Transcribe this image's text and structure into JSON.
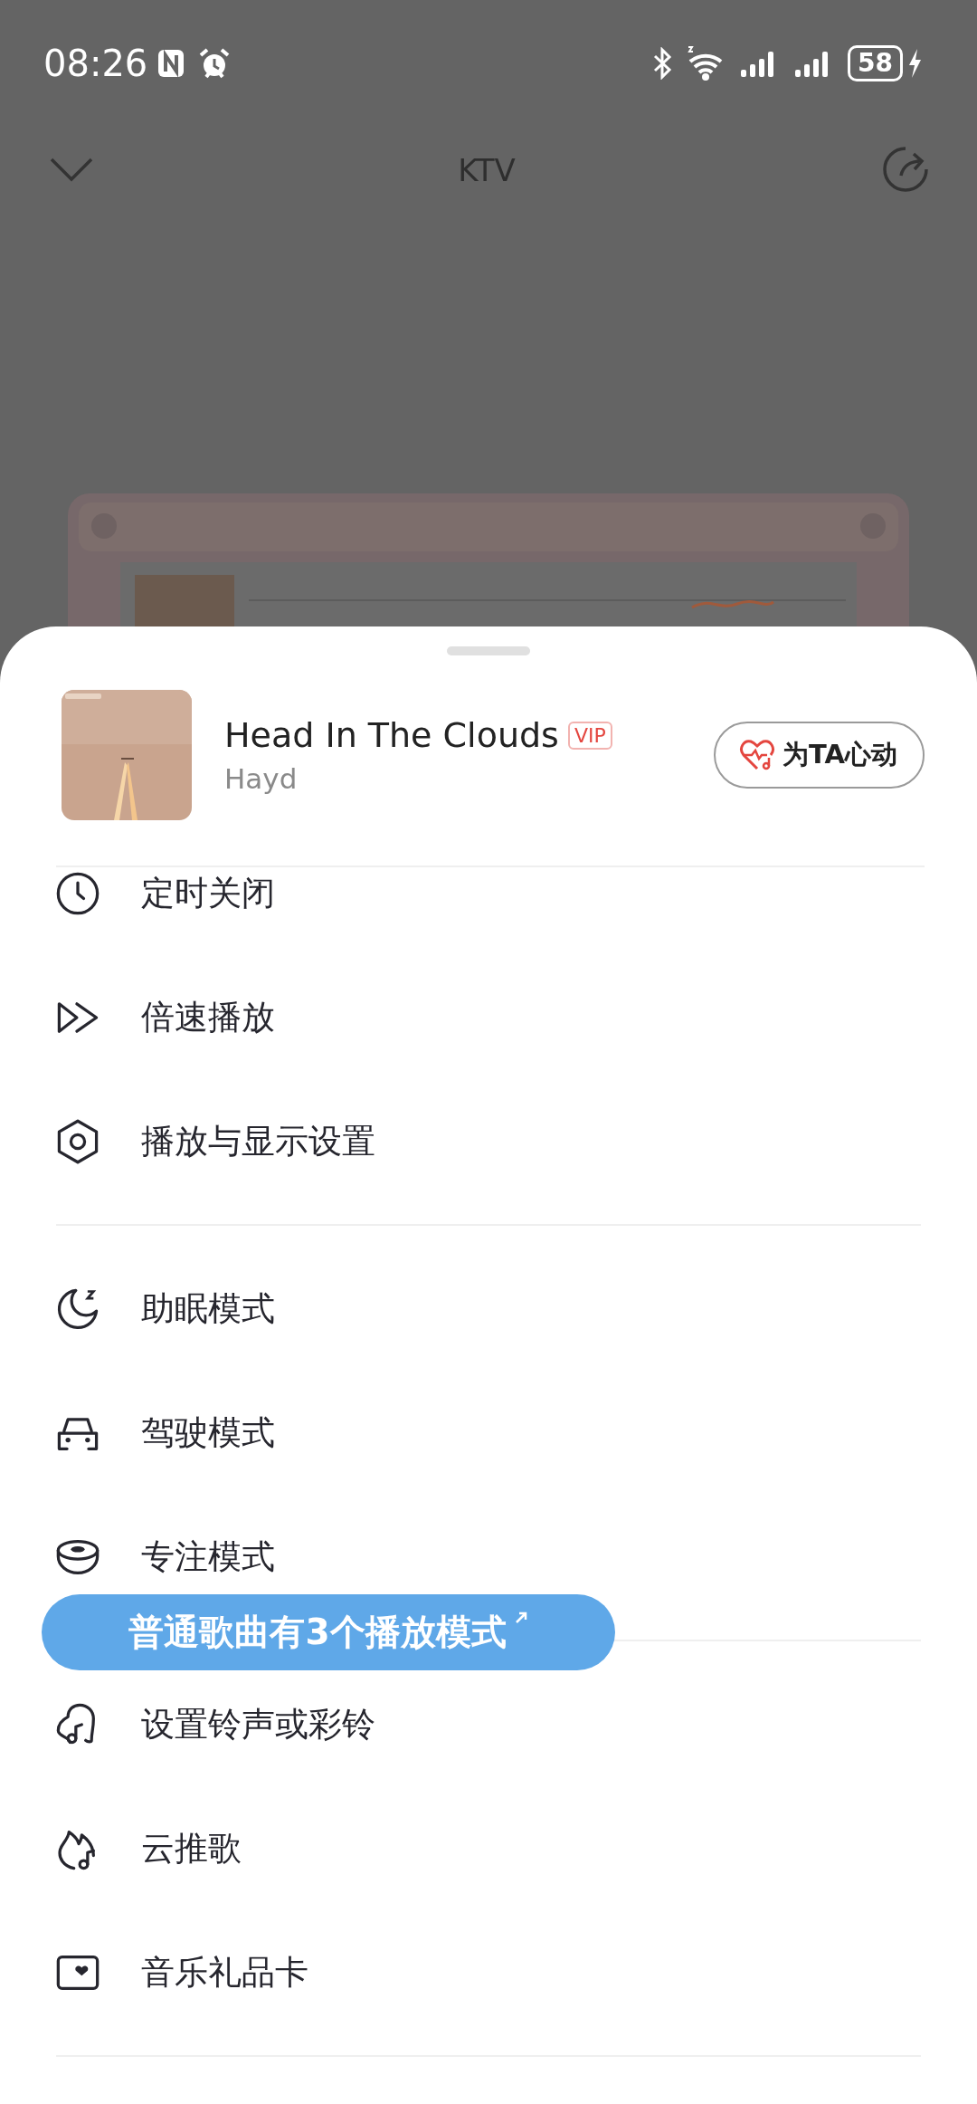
{
  "status_bar": {
    "time": "08:26",
    "battery": "58"
  },
  "header": {
    "title": "KTV"
  },
  "song": {
    "title": "Head In The Clouds",
    "badge": "VIP",
    "artist": "Hayd",
    "action": "为TA心动"
  },
  "menu_groups": [
    [
      {
        "kind": "clock",
        "label": "定时关闭"
      },
      {
        "kind": "speed",
        "label": "倍速播放"
      },
      {
        "kind": "settings",
        "label": "播放与显示设置"
      }
    ],
    [
      {
        "kind": "moon",
        "label": "助眠模式"
      },
      {
        "kind": "car",
        "label": "驾驶模式"
      },
      {
        "kind": "bowl",
        "label": "专注模式"
      }
    ],
    [
      {
        "kind": "bell",
        "label": "设置铃声或彩铃"
      },
      {
        "kind": "flame",
        "label": "云推歌"
      },
      {
        "kind": "card",
        "label": "音乐礼品卡"
      }
    ]
  ],
  "tooltip": {
    "text": "普通歌曲有3个播放模式"
  }
}
